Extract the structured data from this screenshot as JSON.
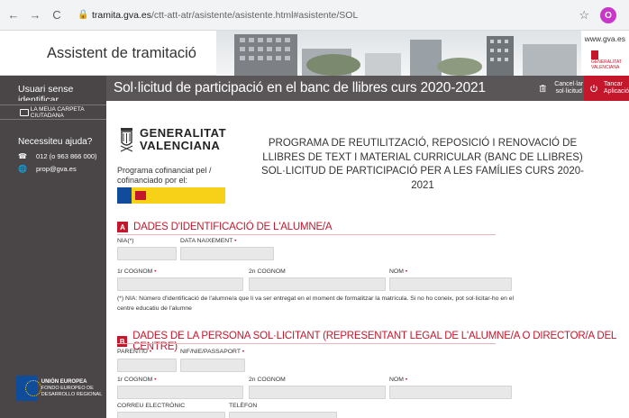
{
  "browser": {
    "back": "←",
    "forward": "→",
    "reload": "C",
    "url_host": "tramita.gva.es",
    "url_path": "/ctt-att-atr/asistente/asistente.html#asistente/SOL",
    "profile_initial": "O"
  },
  "header": {
    "site_title": "Assistent de tramitació",
    "gva_url": "www.gva.es",
    "gva_mini": "GENERALITAT VALENCIANA"
  },
  "titlebar": {
    "user": "Usuari sense identificar",
    "title": "Sol·licitud de participació en el banc de llibres curs 2020-2021",
    "cancel_label": "Cancel·lar sol·licitud",
    "close_label": "Tancar Aplicació"
  },
  "sidebar": {
    "carpeta": "LA MEUA CARPETA CIUTADANA",
    "help_title": "Necessiteu ajuda?",
    "phone": "012 (o 963 866 000)",
    "email": "prop@gva.es",
    "eu_title": "UNIÓN EUROPEA",
    "eu_sub": "FONDO EUROPEO DE DESARROLLO REGIONAL"
  },
  "form": {
    "gva_line1": "GENERALITAT",
    "gva_line2": "VALENCIANA",
    "cofinancing": "Programa cofinanciat pel / cofinanciado por el:",
    "program_title": "PROGRAMA DE REUTILITZACIÓ, REPOSICIÓ I RENOVACIÓ DE LLIBRES DE TEXT I MATERIAL CURRICULAR (BANC DE LLIBRES) SOL·LICITUD DE PARTICIPACIÓ PER A LES FAMÍLIES CURS 2020-2021",
    "section_a_letter": "A",
    "section_a_title": "DADES D'IDENTIFICACIÓ DE L'ALUMNE/A",
    "nia_label": "NIA(*)",
    "birth_label": "DATA NAIXEMENT",
    "surname1_label": "1r COGNOM",
    "surname2_label": "2n COGNOM",
    "name_label": "NOM",
    "nia_note": "(*) NIA: Número d'identificació de l'alumne/a que li va ser entregat en el moment de formalitzar la matrícula. Si no ho coneix, pot sol·licitar-ho en el centre educatiu de l'alumne",
    "section_b_letter": "B",
    "section_b_title": "DADES DE LA PERSONA SOL·LICITANT (REPRESENTANT LEGAL DE L'ALUMNE/A O DIRECTOR/A DEL CENTRE)",
    "relation_label": "PARENTIU",
    "nif_label": "NIF/NIE/PASSAPORT",
    "b_surname1_label": "1r COGNOM",
    "b_surname2_label": "2n COGNOM",
    "b_name_label": "NOM",
    "email_label": "CORREU ELECTRÒNIC",
    "phone_label": "TELÈFON",
    "required_mark": "•"
  },
  "colors": {
    "accent_red": "#c4172c",
    "sidebar_bg": "#4a4647",
    "titlebar_bg": "#5a5556"
  }
}
